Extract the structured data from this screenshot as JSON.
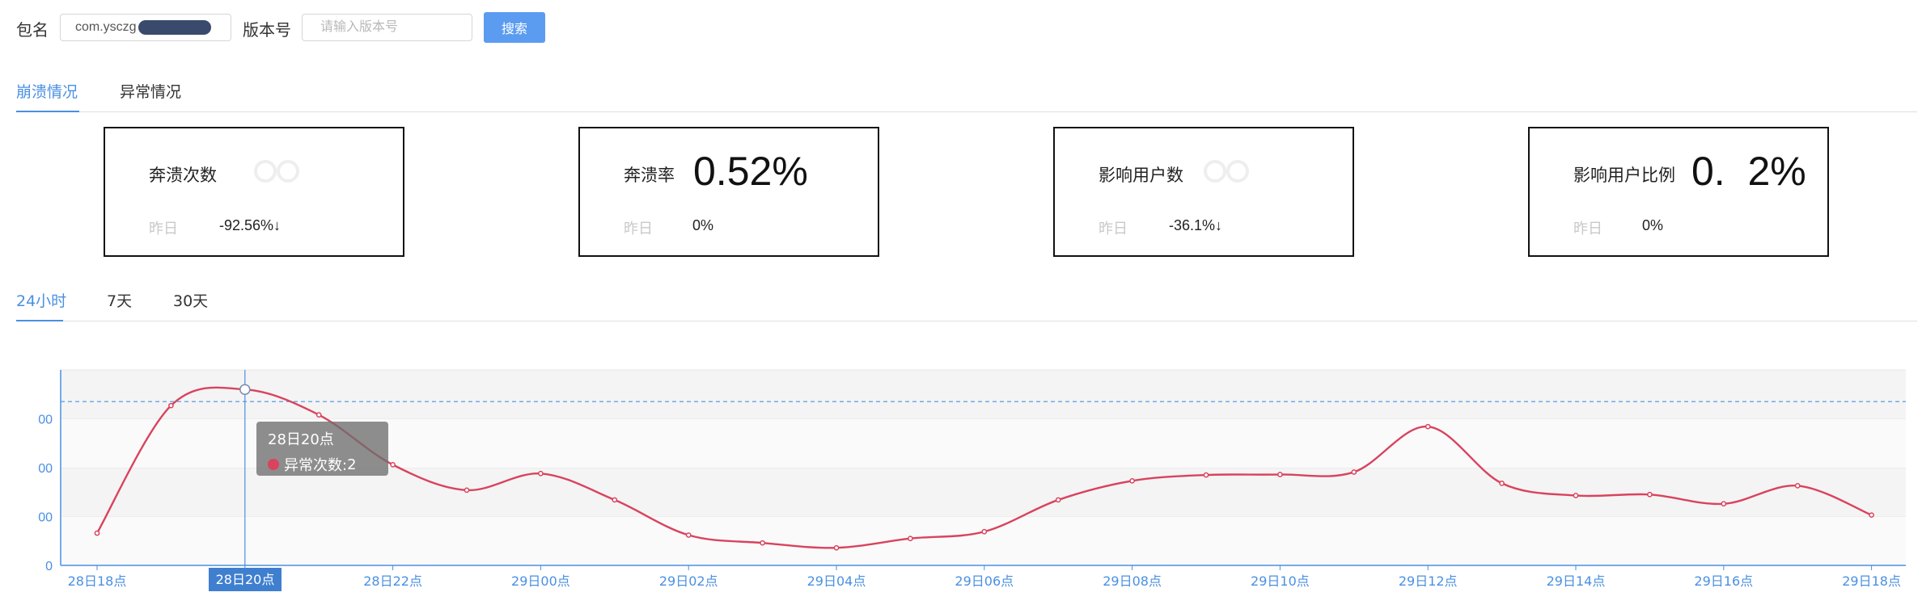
{
  "search": {
    "package_label": "包名",
    "package_value": "com.ysczg",
    "version_label": "版本号",
    "version_placeholder": "请输入版本号",
    "search_button": "搜索"
  },
  "main_tabs": [
    {
      "label": "崩溃情况",
      "active": true
    },
    {
      "label": "异常情况",
      "active": false
    }
  ],
  "cards": [
    {
      "title": "奔溃次数",
      "value": "",
      "yesterday_label": "昨日",
      "yesterday_value": "-92.56%↓"
    },
    {
      "title": "奔溃率",
      "value": "0.52%",
      "yesterday_label": "昨日",
      "yesterday_value": "0%"
    },
    {
      "title": "影响用户数",
      "value": "",
      "yesterday_label": "昨日",
      "yesterday_value": "-36.1%↓"
    },
    {
      "title": "影响用户比例",
      "value": "0.  2%",
      "yesterday_label": "昨日",
      "yesterday_value": "0%"
    }
  ],
  "range_tabs": [
    {
      "label": "24小时",
      "active": true
    },
    {
      "label": "7天",
      "active": false
    },
    {
      "label": "30天",
      "active": false
    }
  ],
  "colors": {
    "accent": "#4a90e2",
    "series": "#d9435e",
    "button": "#5b9cf1",
    "axis": "#4a90e2"
  },
  "chart_data": {
    "type": "line",
    "x": [
      "28日18点",
      "28日19点",
      "28日20点",
      "28日21点",
      "28日22点",
      "28日23点",
      "29日00点",
      "29日01点",
      "29日02点",
      "29日03点",
      "29日04点",
      "29日05点",
      "29日06点",
      "29日07点",
      "29日08点",
      "29日09点",
      "29日10点",
      "29日11点",
      "29日12点",
      "29日13点",
      "29日14点",
      "29日15点",
      "29日16点",
      "29日17点",
      "29日18点"
    ],
    "x_tick_labels": [
      "28日18点",
      "28日20点",
      "28日22点",
      "29日00点",
      "29日02点",
      "29日04点",
      "29日06点",
      "29日08点",
      "29日10点",
      "29日12点",
      "29日14点",
      "29日16点",
      "29日18点"
    ],
    "series": [
      {
        "name": "异常次数",
        "values": [
          66,
          327,
          360,
          308,
          206,
          154,
          188,
          134,
          62,
          46,
          36,
          55,
          69,
          134,
          173,
          185,
          186,
          191,
          284,
          168,
          143,
          145,
          126,
          163,
          103
        ]
      }
    ],
    "y_tick_labels": [
      "0",
      "00",
      "00",
      "00"
    ],
    "ylim": [
      0,
      400
    ],
    "highlighted_index": 2,
    "tooltip": {
      "title": "28日20点",
      "series_label": "异常次数: ",
      "value": "2"
    },
    "grid": true
  }
}
